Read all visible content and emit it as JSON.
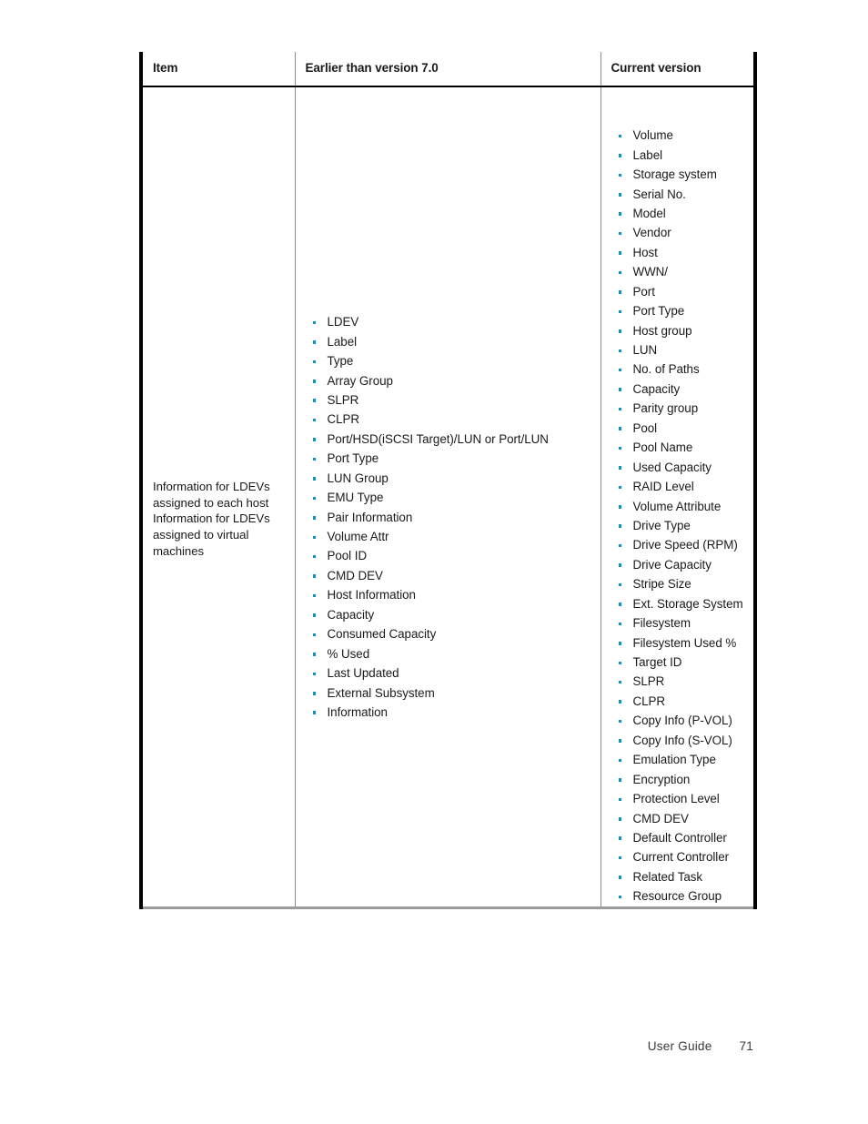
{
  "table": {
    "headers": {
      "item": "Item",
      "earlier": "Earlier than version 7.0",
      "current": "Current version"
    },
    "item_column": {
      "paragraphs": [
        "Information for LDEVs assigned to each host",
        "Information for LDEVs assigned to virtual machines"
      ]
    },
    "earlier_version_items": [
      "LDEV",
      "Label",
      "Type",
      "Array Group",
      "SLPR",
      "CLPR",
      "Port/HSD(iSCSI Target)/LUN or Port/LUN",
      "Port Type",
      "LUN Group",
      "EMU Type",
      "Pair Information",
      "Volume Attr",
      "Pool ID",
      "CMD DEV",
      "Host Information",
      "Capacity",
      "Consumed Capacity",
      "% Used",
      "Last Updated",
      "External Subsystem",
      "Information"
    ],
    "current_version_items": [
      "Volume",
      "Label",
      "Storage system",
      "Serial No.",
      "Model",
      "Vendor",
      "Host",
      "WWN/",
      "Port",
      "Port Type",
      "Host group",
      "LUN",
      "No. of Paths",
      "Capacity",
      "Parity group",
      "Pool",
      "Pool Name",
      "Used Capacity",
      "RAID Level",
      "Volume Attribute",
      "Drive Type",
      "Drive Speed (RPM)",
      "Drive Capacity",
      "Stripe Size",
      "Ext. Storage System",
      "Filesystem",
      "Filesystem Used %",
      "Target ID",
      "SLPR",
      "CLPR",
      "Copy Info (P-VOL)",
      "Copy Info (S-VOL)",
      "Emulation Type",
      "Encryption",
      "Protection Level",
      "CMD DEV",
      "Default Controller",
      "Current Controller",
      "Related Task",
      "Resource Group"
    ]
  },
  "footer": {
    "guide_label": "User Guide",
    "page_number": "71"
  },
  "colors": {
    "bullet": "#0b93c6",
    "rule_heavy": "#000000",
    "rule_light": "#8d8d8d",
    "text": "#1a1a1a"
  }
}
